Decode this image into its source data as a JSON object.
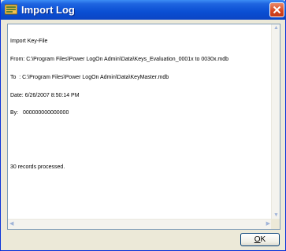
{
  "window": {
    "title": "Import Log",
    "icon": "import-log-app-icon",
    "close_icon": "close-icon"
  },
  "log": {
    "lines": [
      "Import Key-File",
      "From: C:\\Program Files\\Power LogOn Admin\\Data\\Keys_Evaluation_0001x to 0030x.mdb",
      "To  : C:\\Program Files\\Power LogOn Admin\\Data\\KeyMaster.mdb",
      "Date: 6/26/2007 8:50:14 PM",
      "By:   000000000000000",
      "",
      "",
      "30 records processed."
    ]
  },
  "buttons": {
    "ok_label_underlined": "O",
    "ok_label_rest": "K"
  },
  "colors": {
    "titlebar": "#0a4fd3",
    "dialog_bg": "#ece9d8",
    "close_button": "#d6451e"
  }
}
